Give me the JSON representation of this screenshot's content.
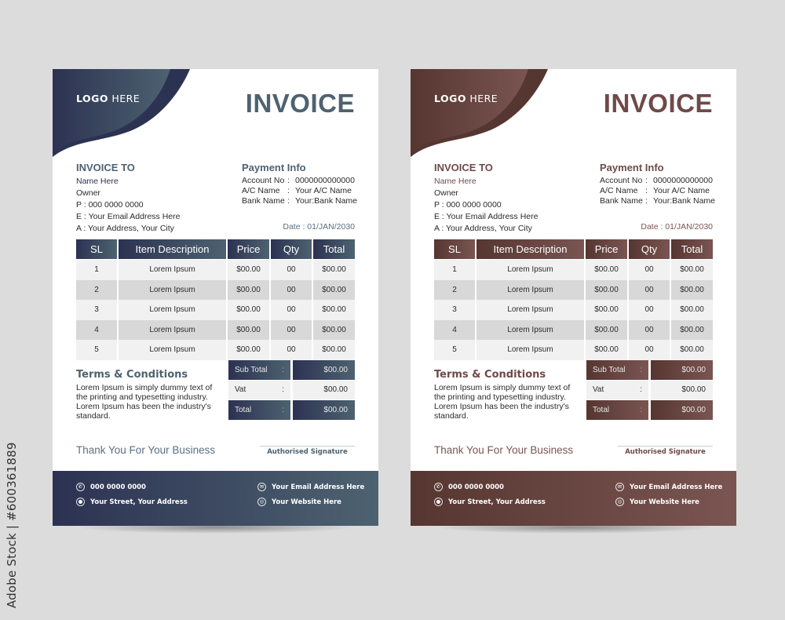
{
  "watermark": {
    "stock_label": "Adobe Stock | #600361889"
  },
  "invoices": [
    {
      "theme": "blue",
      "colors": {
        "primary": "#2c3252",
        "accent": "#4d6270",
        "title": "#4e6271",
        "name": "#2c3252",
        "date": "#5a6f82"
      },
      "logo": {
        "bold": "LOGO",
        "light": "HERE"
      },
      "title": "INVOICE",
      "invoice_to": {
        "heading": "INVOICE TO",
        "name": "Name Here",
        "role": "Owner",
        "phone": "P : 000 0000 0000",
        "email": "E : Your Email Address Here",
        "address": "A : Your Address, Your City"
      },
      "payment_info": {
        "heading": "Payment Info",
        "rows": [
          {
            "key": "Account No",
            "sep": ":",
            "value": "0000000000000"
          },
          {
            "key": "A/C Name",
            "sep": ":",
            "value": "Your A/C Name"
          },
          {
            "key": "Bank Name",
            "sep": ":",
            "value": "Your:Bank Name"
          }
        ]
      },
      "date": "Date : 01/JAN/2030",
      "table": {
        "headers": [
          "SL",
          "Item Description",
          "Price",
          "Qty",
          "Total"
        ],
        "rows": [
          [
            "1",
            "Lorem Ipsum",
            "$00.00",
            "00",
            "$00.00"
          ],
          [
            "2",
            "Lorem Ipsum",
            "$00.00",
            "00",
            "$00.00"
          ],
          [
            "3",
            "Lorem Ipsum",
            "$00.00",
            "00",
            "$00.00"
          ],
          [
            "4",
            "Lorem Ipsum",
            "$00.00",
            "00",
            "$00.00"
          ],
          [
            "5",
            "Lorem Ipsum",
            "$00.00",
            "00",
            "$00.00"
          ]
        ]
      },
      "terms": {
        "heading": "Terms & Conditions",
        "text": "Lorem Ipsum is simply dummy text of the printing and typesetting industry. Lorem Ipsum has been the industry's standard."
      },
      "totals": [
        {
          "label": "Sub Total",
          "sep": ":",
          "value": "$00.00"
        },
        {
          "label": "Vat",
          "sep": ":",
          "value": "$00.00"
        },
        {
          "label": "Total",
          "sep": ":",
          "value": "$00.00"
        }
      ],
      "thanks": "Thank You For Your Business",
      "signature": "Authorised Signature",
      "footer": {
        "phone": "000 0000 0000",
        "address": "Your Street, Your Address",
        "email": "Your Email Address Here",
        "website": "Your Website Here"
      }
    },
    {
      "theme": "brown",
      "colors": {
        "primary": "#563630",
        "accent": "#7a5552",
        "title": "#6e4a48",
        "name": "#6e4a48",
        "date": "#7a5552"
      },
      "logo": {
        "bold": "LOGO",
        "light": "HERE"
      },
      "title": "INVOICE",
      "invoice_to": {
        "heading": "INVOICE TO",
        "name": "Name Here",
        "role": "Owner",
        "phone": "P : 000 0000 0000",
        "email": "E : Your Email Address Here",
        "address": "A : Your Address, Your City"
      },
      "payment_info": {
        "heading": "Payment Info",
        "rows": [
          {
            "key": "Account No",
            "sep": ":",
            "value": "0000000000000"
          },
          {
            "key": "A/C Name",
            "sep": ":",
            "value": "Your A/C Name"
          },
          {
            "key": "Bank Name",
            "sep": ":",
            "value": "Your:Bank Name"
          }
        ]
      },
      "date": "Date : 01/JAN/2030",
      "table": {
        "headers": [
          "SL",
          "Item Description",
          "Price",
          "Qty",
          "Total"
        ],
        "rows": [
          [
            "1",
            "Lorem Ipsum",
            "$00.00",
            "00",
            "$00.00"
          ],
          [
            "2",
            "Lorem Ipsum",
            "$00.00",
            "00",
            "$00.00"
          ],
          [
            "3",
            "Lorem Ipsum",
            "$00.00",
            "00",
            "$00.00"
          ],
          [
            "4",
            "Lorem Ipsum",
            "$00.00",
            "00",
            "$00.00"
          ],
          [
            "5",
            "Lorem Ipsum",
            "$00.00",
            "00",
            "$00.00"
          ]
        ]
      },
      "terms": {
        "heading": "Terms & Conditions",
        "text": "Lorem Ipsum is simply dummy text of the printing and typesetting industry. Lorem Ipsum has been the industry's standard."
      },
      "totals": [
        {
          "label": "Sub Total",
          "sep": ":",
          "value": "$00.00"
        },
        {
          "label": "Vat",
          "sep": ":",
          "value": "$00.00"
        },
        {
          "label": "Total",
          "sep": ":",
          "value": "$00.00"
        }
      ],
      "thanks": "Thank You For Your Business",
      "signature": "Authorised Signature",
      "footer": {
        "phone": "000 0000 0000",
        "address": "Your Street, Your Address",
        "email": "Your Email Address Here",
        "website": "Your Website Here"
      }
    }
  ]
}
